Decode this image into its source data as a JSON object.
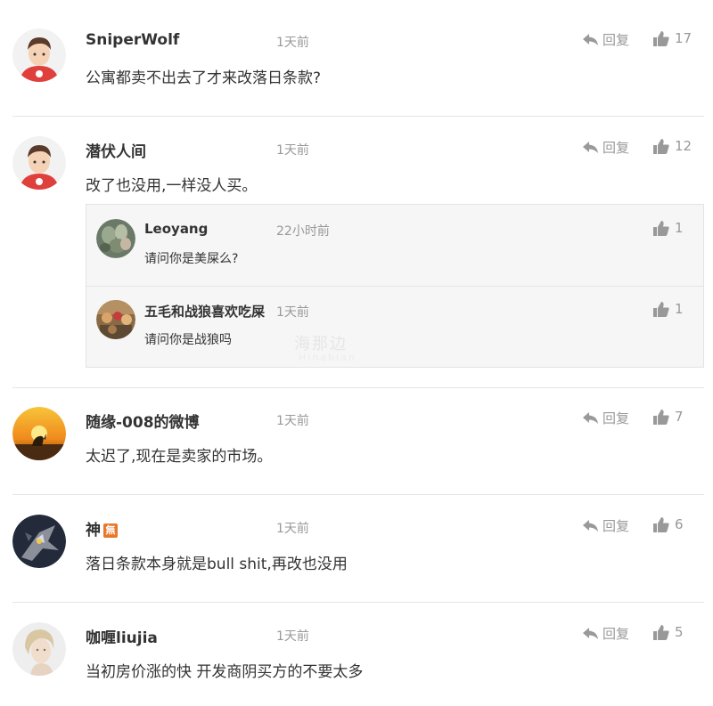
{
  "labels": {
    "reply": "回复"
  },
  "comments": [
    {
      "username": "SniperWolf",
      "time": "1天前",
      "text": "公寓都卖不出去了才来改落日条款?",
      "likes": "17",
      "avatar": "cartoon-man-avatar"
    },
    {
      "username": "潜伏人间",
      "time": "1天前",
      "text": "改了也没用,一样没人买。",
      "likes": "12",
      "avatar": "cartoon-man-avatar",
      "replies": [
        {
          "username": "Leoyang",
          "time": "22小时前",
          "text": "请问你是美屎么?",
          "likes": "1",
          "avatar": "succulent-photo-avatar"
        },
        {
          "username": "五毛和战狼喜欢吃屎",
          "time": "1天前",
          "text": "请问你是战狼吗",
          "likes": "1",
          "avatar": "crowd-photo-avatar"
        }
      ]
    },
    {
      "username": "随缘-008的微博",
      "time": "1天前",
      "text": "太迟了,现在是卖家的市场。",
      "likes": "7",
      "avatar": "kangaroo-sunset-avatar"
    },
    {
      "username": "神",
      "badge": "無",
      "time": "1天前",
      "text": "落日条款本身就是bull shit,再改也没用",
      "likes": "6",
      "avatar": "robot-art-avatar"
    },
    {
      "username": "咖喱liujia",
      "time": "1天前",
      "text": "当初房价涨的快 开发商阴买方的不要太多",
      "likes": "5",
      "avatar": "woman-portrait-avatar"
    }
  ],
  "watermark": {
    "line1": "海那边",
    "line2": "Hinabian"
  },
  "colors": {
    "text": "#333333",
    "muted": "#999999",
    "divider": "#e5e5e5",
    "reply_bg": "#f6f6f6"
  }
}
